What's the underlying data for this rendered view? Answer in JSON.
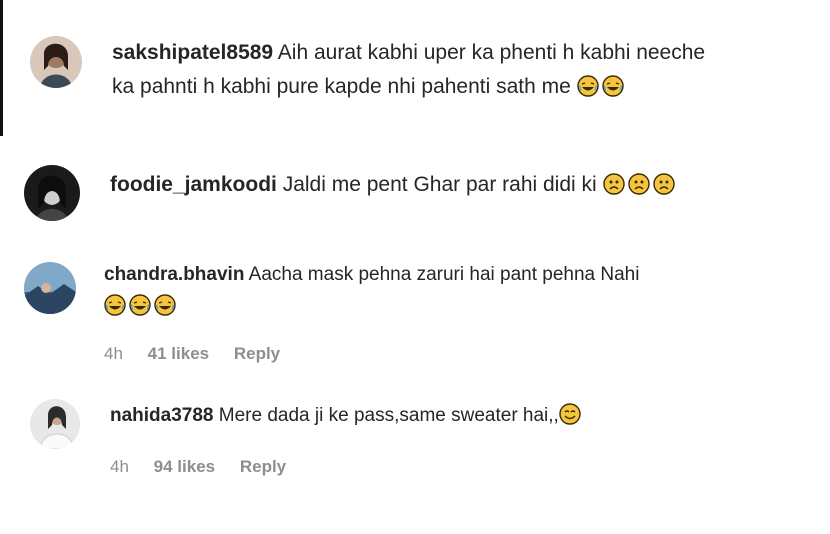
{
  "comments": [
    {
      "username": "sakshipatel8589",
      "line1": "Aih aurat kabhi uper ka phenti h kabhi neeche",
      "line2": "ka pahnti h kabhi pure kapde nhi pahenti sath me",
      "emojis": [
        "laughing-tears-emoji",
        "laughing-tears-emoji"
      ],
      "avatar": "avatar-photo"
    },
    {
      "username": "foodie_jamkoodi",
      "line1": "Jaldi me pent Ghar par rahi didi ki",
      "emojis": [
        "frowning-emoji",
        "frowning-emoji",
        "frowning-emoji"
      ],
      "avatar": "avatar-photo"
    },
    {
      "username": "chandra.bhavin",
      "line1": "Aacha mask pehna zaruri hai pant pehna Nahi",
      "emojis": [
        "laughing-tears-emoji",
        "laughing-tears-emoji",
        "laughing-tears-emoji"
      ],
      "time": "4h",
      "likes": "41 likes",
      "reply": "Reply",
      "avatar": "avatar-photo"
    },
    {
      "username": "nahida3788",
      "line1": "Mere dada ji ke pass,same sweater hai,,",
      "emojis": [
        "smiling-emoji"
      ],
      "time": "4h",
      "likes": "94 likes",
      "reply": "Reply",
      "avatar": "avatar-photo"
    }
  ],
  "colors": {
    "text": "#262626",
    "meta": "#8e8e8e",
    "emoji": "#f5c542",
    "emoji_outline": "#3a2a00"
  }
}
